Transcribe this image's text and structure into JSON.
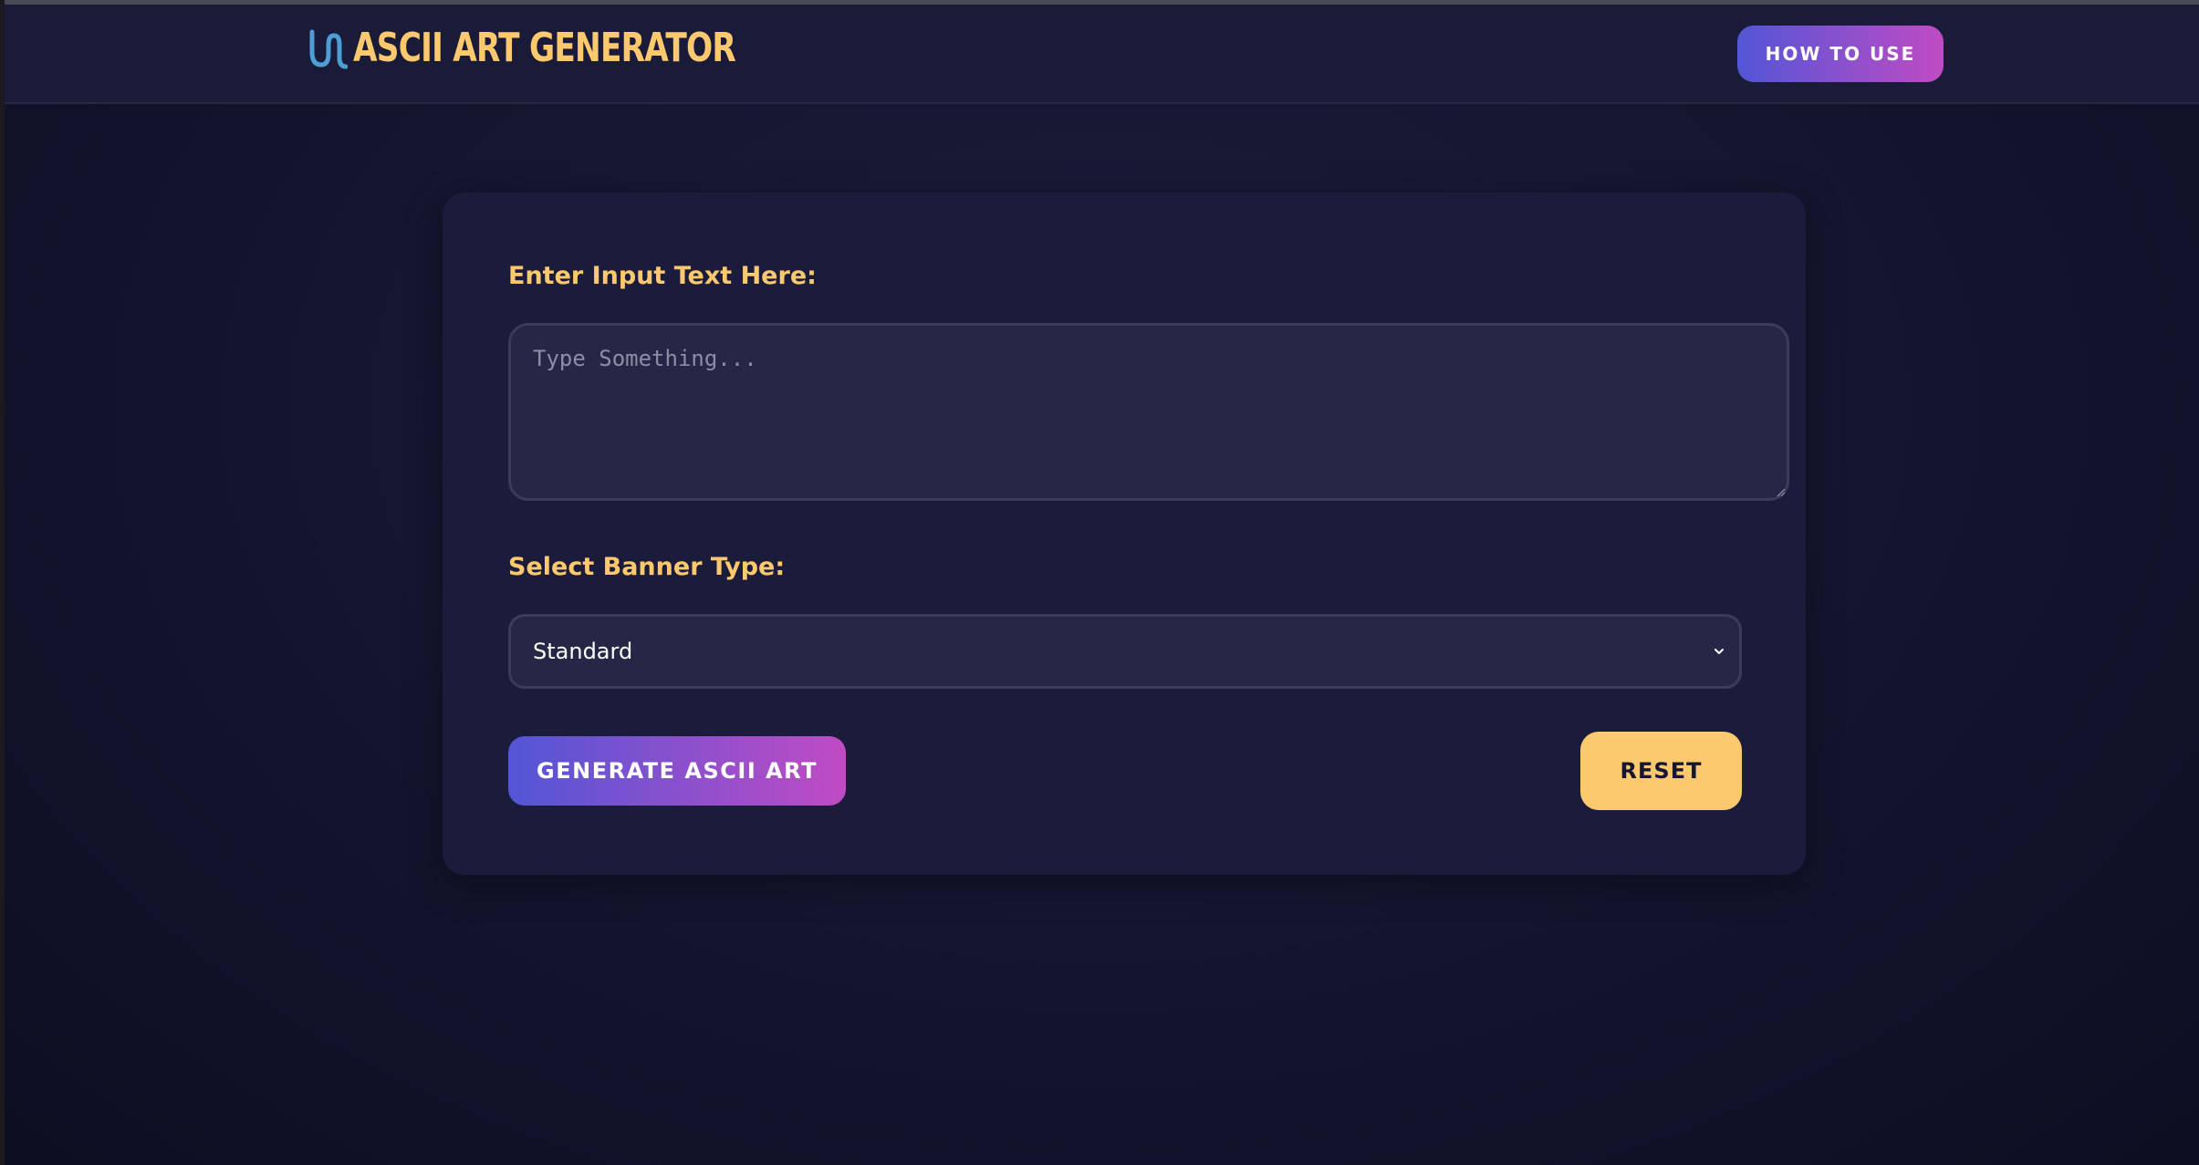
{
  "header": {
    "logo_text": "ASCII ART GENERATOR",
    "logo_icon": "wave-icon",
    "how_to_use_label": "HOW TO USE"
  },
  "form": {
    "input_label": "Enter Input Text Here:",
    "input_placeholder": "Type Something...",
    "input_value": "",
    "banner_label": "Select Banner Type:",
    "banner_selected": "Standard",
    "generate_label": "GENERATE ASCII ART",
    "reset_label": "RESET"
  },
  "colors": {
    "accent_yellow": "#fdc96f",
    "gradient_start": "#5256d6",
    "gradient_end": "#c04bc4",
    "background": "#15162f",
    "logo_icon_color": "#4e9ed6"
  }
}
